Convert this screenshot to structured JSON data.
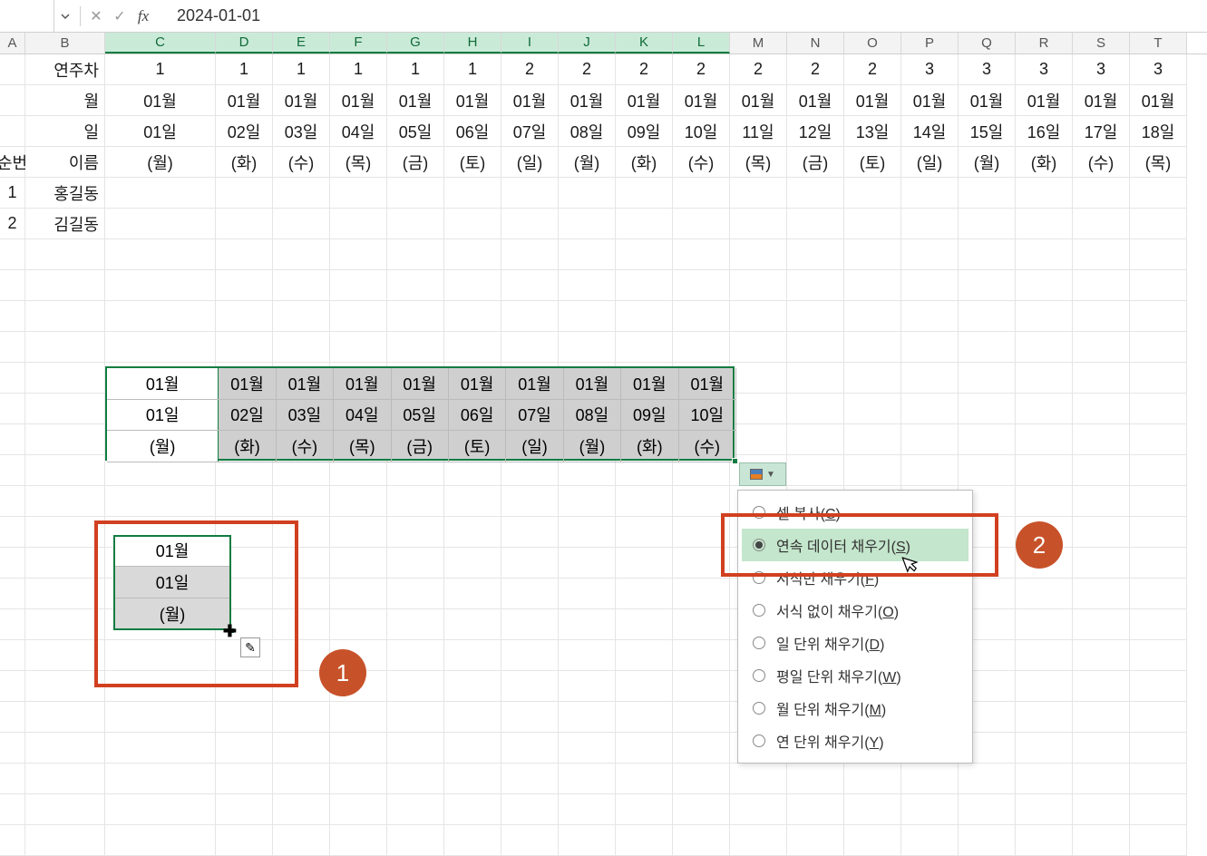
{
  "formula_bar": {
    "name_box": "",
    "cancel": "✕",
    "accept": "✓",
    "fx_label": "fx",
    "value": "2024-01-01"
  },
  "columns": [
    "A",
    "B",
    "C",
    "D",
    "E",
    "F",
    "G",
    "H",
    "I",
    "J",
    "K",
    "L",
    "M",
    "N",
    "O",
    "P",
    "Q",
    "R",
    "S",
    "T"
  ],
  "selected_cols": [
    "C",
    "D",
    "E",
    "F",
    "G",
    "H",
    "I",
    "J",
    "K",
    "L"
  ],
  "table_rows": [
    {
      "label": "연주차",
      "values": [
        "1",
        "1",
        "1",
        "1",
        "1",
        "1",
        "2",
        "2",
        "2",
        "2",
        "2",
        "2",
        "2",
        "3",
        "3",
        "3",
        "3",
        "3"
      ]
    },
    {
      "label": "월",
      "values": [
        "01월",
        "01월",
        "01월",
        "01월",
        "01월",
        "01월",
        "01월",
        "01월",
        "01월",
        "01월",
        "01월",
        "01월",
        "01월",
        "01월",
        "01월",
        "01월",
        "01월",
        "01월"
      ]
    },
    {
      "label": "일",
      "values": [
        "01일",
        "02일",
        "03일",
        "04일",
        "05일",
        "06일",
        "07일",
        "08일",
        "09일",
        "10일",
        "11일",
        "12일",
        "13일",
        "14일",
        "15일",
        "16일",
        "17일",
        "18일"
      ]
    },
    {
      "label": "_dow_",
      "a": "순번",
      "b": "이름",
      "values": [
        "(월)",
        "(화)",
        "(수)",
        "(목)",
        "(금)",
        "(토)",
        "(일)",
        "(월)",
        "(화)",
        "(수)",
        "(목)",
        "(금)",
        "(토)",
        "(일)",
        "(월)",
        "(화)",
        "(수)",
        "(목)"
      ]
    }
  ],
  "names": [
    {
      "seq": "1",
      "name": "홍길동"
    },
    {
      "seq": "2",
      "name": "김길동"
    }
  ],
  "fill_block": {
    "rows": [
      [
        "01월",
        "01월",
        "01월",
        "01월",
        "01월",
        "01월",
        "01월",
        "01월",
        "01월",
        "01월"
      ],
      [
        "01일",
        "02일",
        "03일",
        "04일",
        "05일",
        "06일",
        "07일",
        "08일",
        "09일",
        "10일"
      ],
      [
        "(월)",
        "(화)",
        "(수)",
        "(목)",
        "(금)",
        "(토)",
        "(일)",
        "(월)",
        "(화)",
        "(수)"
      ]
    ]
  },
  "sample_block": {
    "rows": [
      "01월",
      "01일",
      "(월)"
    ]
  },
  "autofill_menu": {
    "items": [
      {
        "label_pre": "셀 복사(",
        "key": "C",
        "label_post": ")",
        "selected": false
      },
      {
        "label_pre": "연속 데이터 채우기(",
        "key": "S",
        "label_post": ")",
        "selected": true
      },
      {
        "label_pre": "서식만 채우기(",
        "key": "F",
        "label_post": ")",
        "selected": false
      },
      {
        "label_pre": "서식 없이 채우기(",
        "key": "O",
        "label_post": ")",
        "selected": false
      },
      {
        "label_pre": "일 단위 채우기(",
        "key": "D",
        "label_post": ")",
        "selected": false
      },
      {
        "label_pre": "평일 단위 채우기(",
        "key": "W",
        "label_post": ")",
        "selected": false
      },
      {
        "label_pre": "월 단위 채우기(",
        "key": "M",
        "label_post": ")",
        "selected": false
      },
      {
        "label_pre": "연 단위 채우기(",
        "key": "Y",
        "label_post": ")",
        "selected": false
      }
    ]
  },
  "annotations": {
    "badge1": "1",
    "badge2": "2"
  }
}
